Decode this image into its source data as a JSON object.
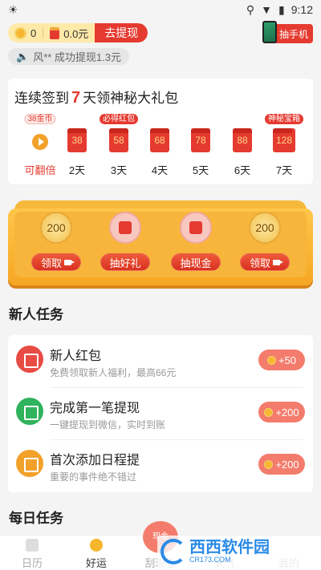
{
  "status_bar": {
    "time": "9:12"
  },
  "top": {
    "coin_count": "0",
    "cash_amount": "0.0元",
    "withdraw_label": "去提现",
    "phone_label": "抽手机",
    "ticker_text": "风** 成功提现1.3元"
  },
  "signin": {
    "title_prefix": "连续签到",
    "title_days": "7",
    "title_suffix": "天领神秘大礼包",
    "days": [
      {
        "tag": "38金币",
        "amount": "",
        "label": "可翻倍"
      },
      {
        "tag": "",
        "amount": "38",
        "label": "2天"
      },
      {
        "tag": "必得红包",
        "amount": "58",
        "label": "3天"
      },
      {
        "tag": "",
        "amount": "68",
        "label": "4天"
      },
      {
        "tag": "",
        "amount": "78",
        "label": "5天"
      },
      {
        "tag": "",
        "amount": "88",
        "label": "6天"
      },
      {
        "tag": "神秘宝箱",
        "amount": "128",
        "label": "7天"
      }
    ]
  },
  "chest": {
    "slots": [
      {
        "value": "200",
        "button": "领取"
      },
      {
        "value": "",
        "button": "抽好礼"
      },
      {
        "value": "",
        "button": "抽现金"
      },
      {
        "value": "200",
        "button": "领取"
      }
    ]
  },
  "newbie_section": "新人任务",
  "tasks": [
    {
      "name": "新人红包",
      "desc": "免费领取新人福利，最高66元",
      "reward": "+50",
      "color": "#e94b45"
    },
    {
      "name": "完成第一笔提现",
      "desc": "一键提现到微信，实时到账",
      "reward": "+200",
      "color": "#2fb35c"
    },
    {
      "name": "首次添加日程提",
      "desc": "重要的事件绝不错过",
      "reward": "+200",
      "color": "#f2a12b"
    }
  ],
  "daily_section": "每日任务",
  "tabbar": {
    "tabs": [
      {
        "label": "日历"
      },
      {
        "label": "好运"
      },
      {
        "label": "刮现金"
      },
      {
        "label": "天气"
      },
      {
        "label": "我的"
      }
    ],
    "float_badge": "现金"
  },
  "watermark": {
    "name": "西西软件园",
    "url": "CR173.COM"
  }
}
